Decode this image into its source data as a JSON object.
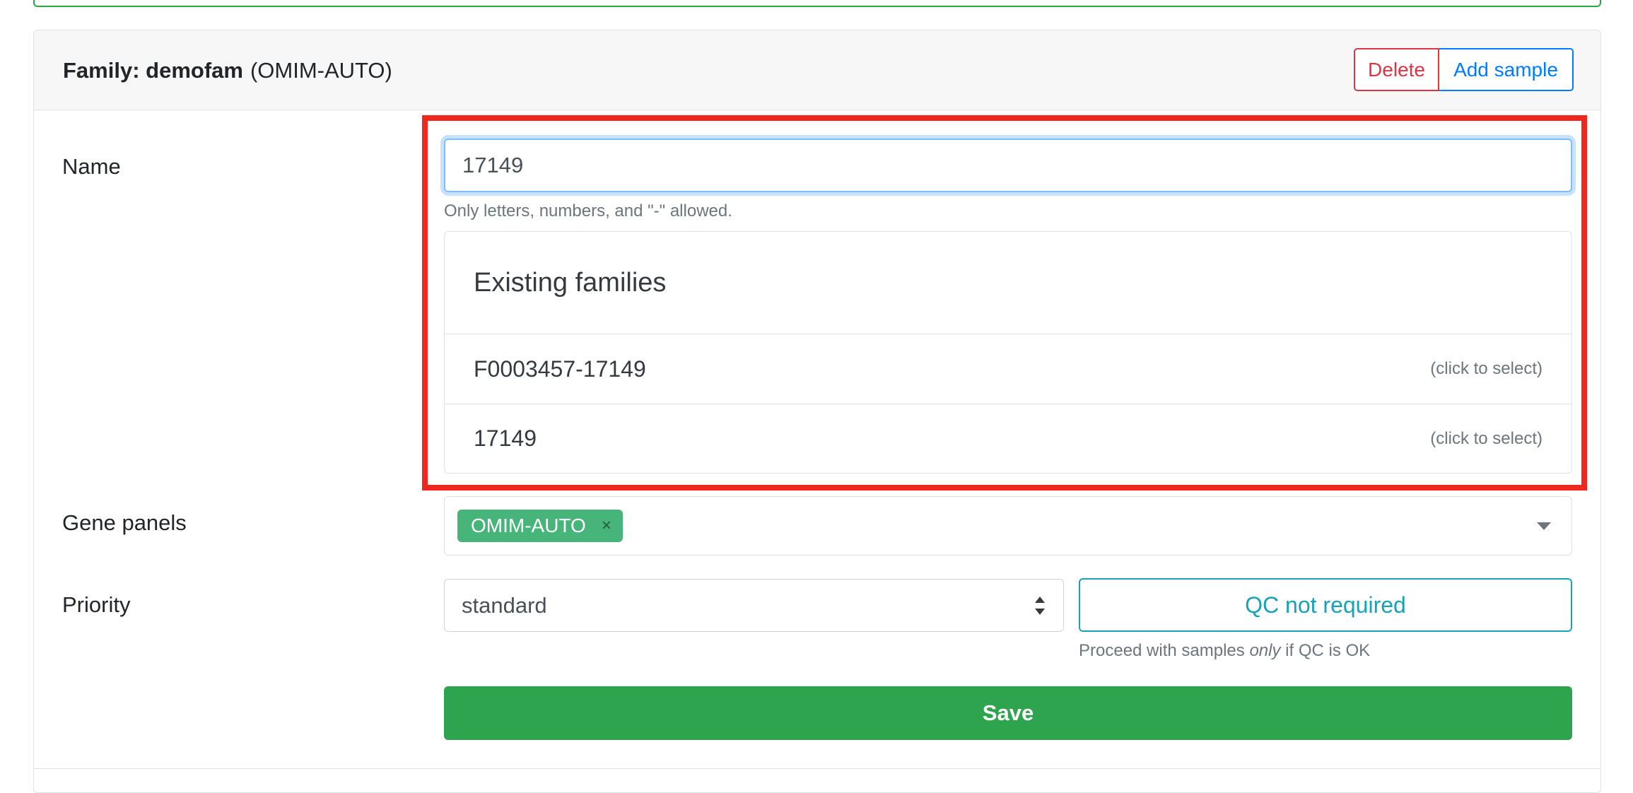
{
  "family": {
    "label": "Family: demofam",
    "panel": "(OMIM-AUTO)"
  },
  "actions": {
    "delete_label": "Delete",
    "add_sample_label": "Add sample"
  },
  "form": {
    "name": {
      "label": "Name",
      "value": "17149",
      "help": "Only letters, numbers, and \"-\" allowed."
    },
    "existing_families": {
      "title": "Existing families",
      "items": [
        {
          "name": "F0003457-17149",
          "hint": "(click to select)"
        },
        {
          "name": "17149",
          "hint": "(click to select)"
        }
      ]
    },
    "gene_panels": {
      "label": "Gene panels",
      "tags": [
        "OMIM-AUTO"
      ],
      "remove_glyph": "×"
    },
    "priority": {
      "label": "Priority",
      "selected": "standard"
    },
    "qc": {
      "button_label": "QC not required",
      "help_prefix": "Proceed with samples ",
      "help_emphasis": "only",
      "help_suffix": " if QC is OK"
    },
    "save_label": "Save"
  },
  "colors": {
    "highlight": "#f0271f",
    "success": "#2ea44f",
    "tag": "#47b47a",
    "info": "#17a2b8",
    "danger": "#dc3545",
    "primary": "#007bff"
  },
  "icons": {
    "dropdown": "chevron-down-icon",
    "select_arrows": "sort-arrows-icon",
    "tag_remove": "close-icon"
  }
}
